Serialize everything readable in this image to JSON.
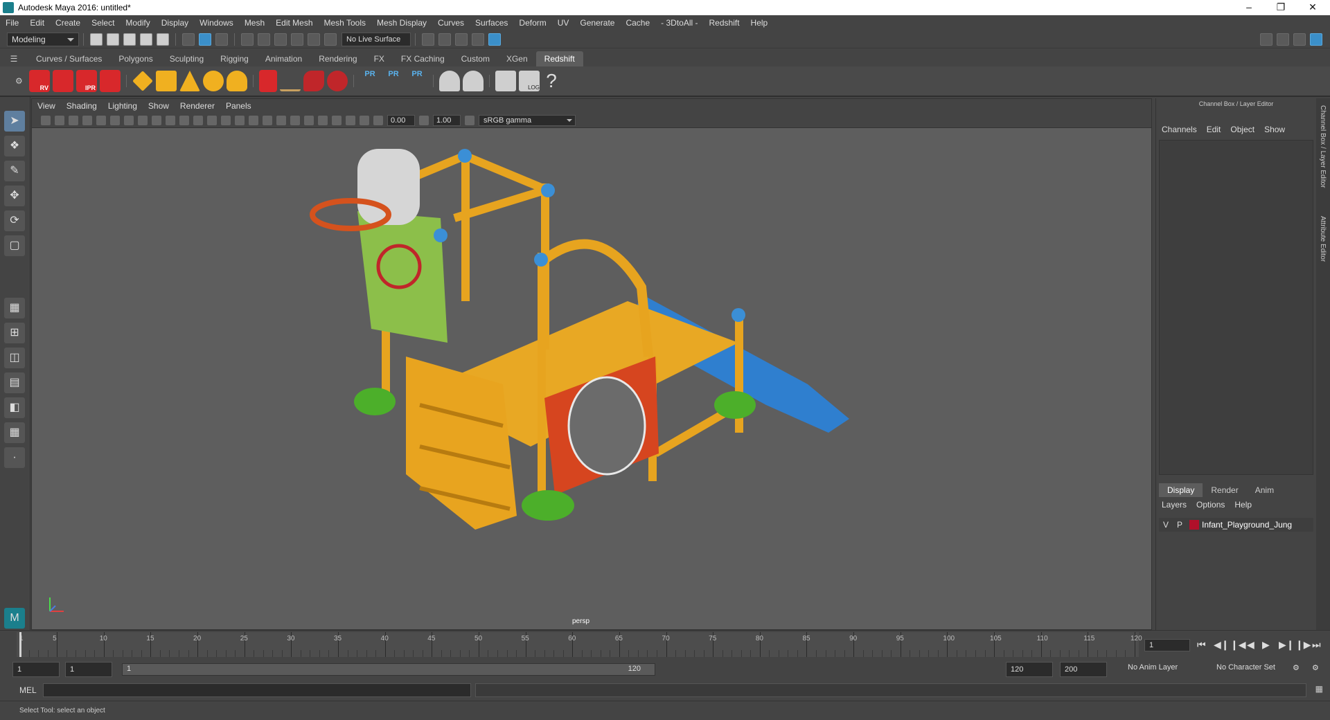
{
  "window": {
    "title": "Autodesk Maya 2016: untitled*"
  },
  "menu": [
    "File",
    "Edit",
    "Create",
    "Select",
    "Modify",
    "Display",
    "Windows",
    "Mesh",
    "Edit Mesh",
    "Mesh Tools",
    "Mesh Display",
    "Curves",
    "Surfaces",
    "Deform",
    "UV",
    "Generate",
    "Cache",
    "- 3DtoAll -",
    "Redshift",
    "Help"
  ],
  "status": {
    "mode": "Modeling",
    "live_surface": "No Live Surface"
  },
  "shelf": {
    "tabs": [
      "Curves / Surfaces",
      "Polygons",
      "Sculpting",
      "Rigging",
      "Animation",
      "Rendering",
      "FX",
      "FX Caching",
      "Custom",
      "XGen",
      "Redshift"
    ],
    "active_tab": "Redshift",
    "icons": [
      {
        "name": "rv-icon",
        "label": "RV"
      },
      {
        "name": "render-icon",
        "label": ""
      },
      {
        "name": "ipr-icon",
        "label": "IPR"
      },
      {
        "name": "render-settings-icon",
        "label": ""
      },
      {
        "name": "pr-icon-1",
        "label": "PR"
      },
      {
        "name": "pr-icon-2",
        "label": "PR"
      },
      {
        "name": "pr-icon-3",
        "label": "PR"
      }
    ],
    "log_label": "LOG",
    "help_glyph": "?"
  },
  "viewport": {
    "menu": [
      "View",
      "Shading",
      "Lighting",
      "Show",
      "Renderer",
      "Panels"
    ],
    "exposure": "0.00",
    "gamma": "1.00",
    "color_space": "sRGB gamma",
    "camera": "persp"
  },
  "channel_box": {
    "title": "Channel Box / Layer Editor",
    "menu": [
      "Channels",
      "Edit",
      "Object",
      "Show"
    ]
  },
  "layer_editor": {
    "tabs": [
      "Display",
      "Render",
      "Anim"
    ],
    "active_tab": "Display",
    "menu": [
      "Layers",
      "Options",
      "Help"
    ],
    "layers": [
      {
        "v": "V",
        "p": "P",
        "name": "Infant_Playground_Jung",
        "color": "#b0102a"
      }
    ]
  },
  "side_tabs": {
    "top": "Channel Box / Layer Editor",
    "bottom": "Attribute Editor"
  },
  "timeline": {
    "ticks": [
      5,
      10,
      15,
      20,
      25,
      30,
      35,
      40,
      45,
      50,
      55,
      60,
      65,
      70,
      75,
      80,
      85,
      90,
      95,
      100,
      105,
      110,
      115,
      120
    ],
    "start_label": "1",
    "current_frame": "1"
  },
  "range": {
    "start": "1",
    "playback_start": "1",
    "slider_start": "1",
    "slider_end": "120",
    "playback_end": "120",
    "end": "200",
    "anim_layer": "No Anim Layer",
    "character_set": "No Character Set"
  },
  "mel": {
    "label": "MEL"
  },
  "help_line": "Select Tool: select an object"
}
